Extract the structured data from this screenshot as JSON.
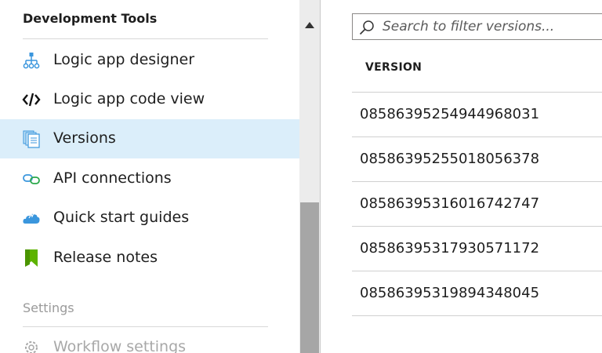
{
  "sidebar": {
    "section_title": "Development Tools",
    "items": [
      {
        "label": "Logic app designer",
        "icon": "hierarchy-icon"
      },
      {
        "label": "Logic app code view",
        "icon": "code-icon"
      },
      {
        "label": "Versions",
        "icon": "versions-icon",
        "selected": true
      },
      {
        "label": "API connections",
        "icon": "link-icon"
      },
      {
        "label": "Quick start guides",
        "icon": "cloud-icon"
      },
      {
        "label": "Release notes",
        "icon": "bookmark-icon"
      }
    ],
    "settings_title": "Settings",
    "settings_items": [
      {
        "label": "Workflow settings",
        "icon": "gear-icon"
      }
    ]
  },
  "search": {
    "placeholder": "Search to filter versions..."
  },
  "table": {
    "column_header": "VERSION",
    "rows": [
      "08586395254944968031",
      "08586395255018056378",
      "08586395316016742747",
      "08586395317930571172",
      "08586395319894348045"
    ]
  },
  "colors": {
    "selected_bg": "#dbeefa",
    "accent_blue": "#3a96dd",
    "bookmark_green": "#5db300"
  }
}
